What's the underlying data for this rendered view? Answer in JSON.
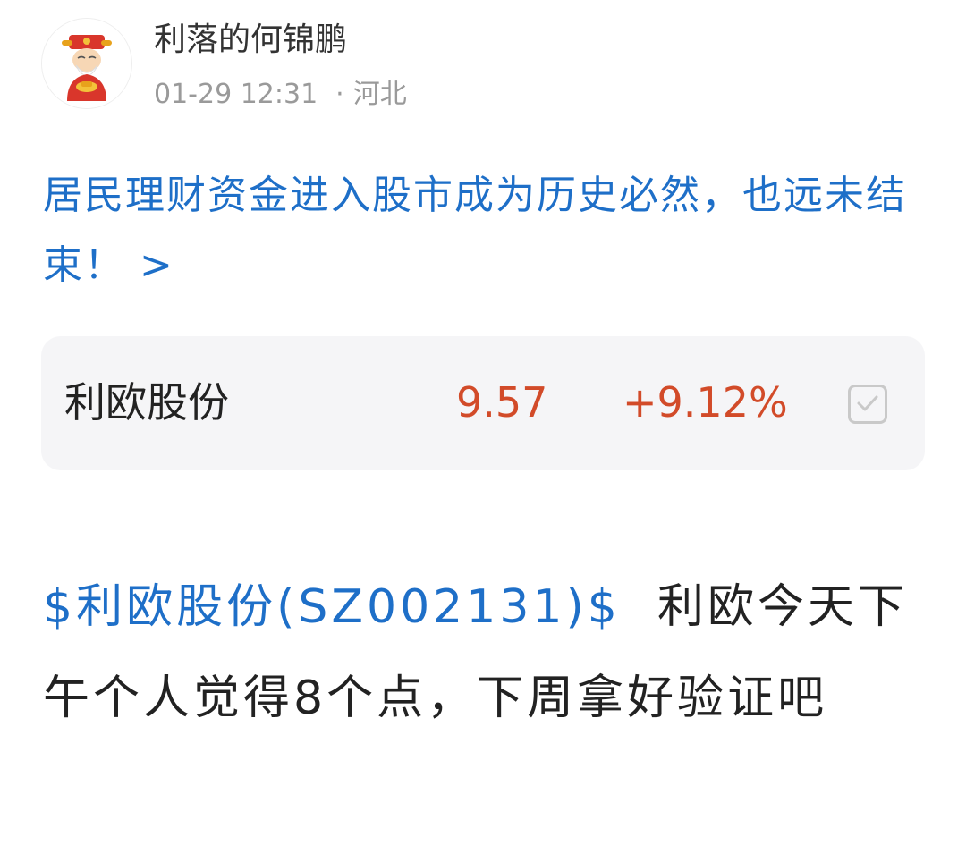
{
  "author": {
    "avatar_icon": "caishen-avatar-icon",
    "name": "利落的何锦鹏",
    "time": "01-29 12:31",
    "separator": "·",
    "location": "河北"
  },
  "headline": "居民理财资金进入股市成为历史必然，也远未结束！ >",
  "stock_card": {
    "name": "利欧股份",
    "price": "9.57",
    "change": "+9.12%",
    "action_icon": "add-to-watchlist-checkbox-icon"
  },
  "post": {
    "stock_link": "$利欧股份(SZ002131)$",
    "text": "利欧今天下午个人觉得8个点，下周拿好验证吧"
  },
  "colors": {
    "link_blue": "#1e6fc8",
    "rise_red": "#d24b29",
    "card_bg": "#f5f5f7",
    "meta_gray": "#9a9a9a"
  }
}
